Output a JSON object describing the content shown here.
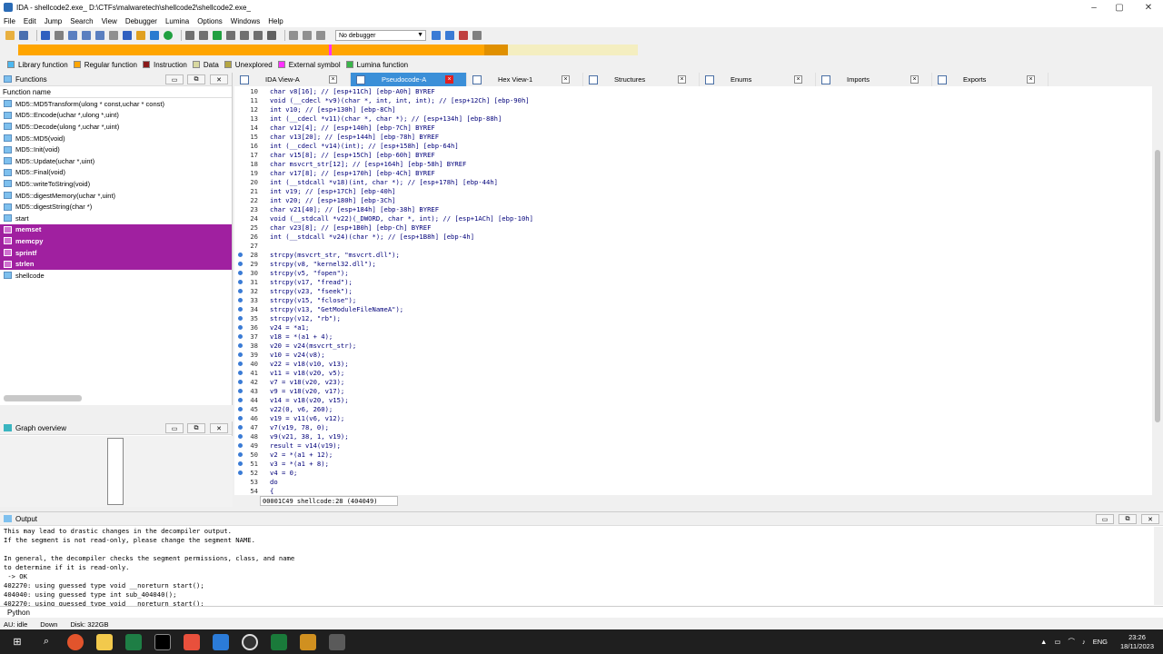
{
  "window": {
    "title": "IDA - shellcode2.exe_ D:\\CTFs\\malwaretech\\shellcode2\\shellcode2.exe_",
    "controls": [
      "–",
      "▢",
      "✕"
    ]
  },
  "menu": [
    "File",
    "Edit",
    "Jump",
    "Search",
    "View",
    "Debugger",
    "Lumina",
    "Options",
    "Windows",
    "Help"
  ],
  "toolbar": {
    "debugger": "No debugger"
  },
  "legend": [
    {
      "label": "Library function",
      "color": "#4db8f0"
    },
    {
      "label": "Regular function",
      "color": "#ffa500"
    },
    {
      "label": "Instruction",
      "color": "#8b1a1a"
    },
    {
      "label": "Data",
      "color": "#d8d8a0"
    },
    {
      "label": "Unexplored",
      "color": "#b5a642"
    },
    {
      "label": "External symbol",
      "color": "#ff30ff"
    },
    {
      "label": "Lumina function",
      "color": "#3ab54a"
    }
  ],
  "functions": {
    "title": "Functions",
    "column": "Function name",
    "items": [
      {
        "name": "MD5::MD5Transform(ulong * const,uchar * const)",
        "lib": false
      },
      {
        "name": "MD5::Encode(uchar *,ulong *,uint)",
        "lib": false
      },
      {
        "name": "MD5::Decode(ulong *,uchar *,uint)",
        "lib": false
      },
      {
        "name": "MD5::MD5(void)",
        "lib": false
      },
      {
        "name": "MD5::Init(void)",
        "lib": false
      },
      {
        "name": "MD5::Update(uchar *,uint)",
        "lib": false
      },
      {
        "name": "MD5::Final(void)",
        "lib": false
      },
      {
        "name": "MD5::writeToString(void)",
        "lib": false
      },
      {
        "name": "MD5::digestMemory(uchar *,uint)",
        "lib": false
      },
      {
        "name": "MD5::digestString(char *)",
        "lib": false
      },
      {
        "name": "start",
        "lib": false
      },
      {
        "name": "memset",
        "lib": true
      },
      {
        "name": "memcpy",
        "lib": true
      },
      {
        "name": "sprintf",
        "lib": true
      },
      {
        "name": "strlen",
        "lib": true
      },
      {
        "name": "shellcode",
        "lib": false
      }
    ]
  },
  "graph_overview": {
    "title": "Graph overview"
  },
  "tabs": [
    {
      "label": "IDA View-A",
      "active": false
    },
    {
      "label": "Pseudocode-A",
      "active": true
    },
    {
      "label": "Hex View-1",
      "active": false
    },
    {
      "label": "Structures",
      "active": false
    },
    {
      "label": "Enums",
      "active": false
    },
    {
      "label": "Imports",
      "active": false
    },
    {
      "label": "Exports",
      "active": false
    }
  ],
  "code": [
    {
      "n": "10",
      "t": "char v8[16]; // [esp+11Ch] [ebp-A0h] BYREF",
      "dot": false
    },
    {
      "n": "11",
      "t": "void (__cdecl *v9)(char *, int, int, int); // [esp+12Ch] [ebp-90h]",
      "dot": false
    },
    {
      "n": "12",
      "t": "int v10; // [esp+130h] [ebp-8Ch]",
      "dot": false
    },
    {
      "n": "13",
      "t": "int (__cdecl *v11)(char *, char *); // [esp+134h] [ebp-88h]",
      "dot": false
    },
    {
      "n": "14",
      "t": "char v12[4]; // [esp+140h] [ebp-7Ch] BYREF",
      "dot": false
    },
    {
      "n": "15",
      "t": "char v13[20]; // [esp+144h] [ebp-78h] BYREF",
      "dot": false
    },
    {
      "n": "16",
      "t": "int (__cdecl *v14)(int); // [esp+158h] [ebp-64h]",
      "dot": false
    },
    {
      "n": "17",
      "t": "char v15[8]; // [esp+15Ch] [ebp-60h] BYREF",
      "dot": false
    },
    {
      "n": "18",
      "t": "char msvcrt_str[12]; // [esp+164h] [ebp-58h] BYREF",
      "dot": false
    },
    {
      "n": "19",
      "t": "char v17[8]; // [esp+170h] [ebp-4Ch] BYREF",
      "dot": false
    },
    {
      "n": "20",
      "t": "int (__stdcall *v18)(int, char *); // [esp+178h] [ebp-44h]",
      "dot": false
    },
    {
      "n": "21",
      "t": "int v19; // [esp+17Ch] [ebp-40h]",
      "dot": false
    },
    {
      "n": "22",
      "t": "int v20; // [esp+180h] [ebp-3Ch]",
      "dot": false
    },
    {
      "n": "23",
      "t": "char v21[40]; // [esp+184h] [ebp-38h] BYREF",
      "dot": false
    },
    {
      "n": "24",
      "t": "void (__stdcall *v22)(_DWORD, char *, int); // [esp+1ACh] [ebp-10h]",
      "dot": false
    },
    {
      "n": "25",
      "t": "char v23[8]; // [esp+1B0h] [ebp-Ch] BYREF",
      "dot": false
    },
    {
      "n": "26",
      "t": "int (__stdcall *v24)(char *); // [esp+1B8h] [ebp-4h]",
      "dot": false
    },
    {
      "n": "27",
      "t": "",
      "dot": false
    },
    {
      "n": "28",
      "t": "strcpy(msvcrt_str, \"msvcrt.dll\");",
      "dot": true
    },
    {
      "n": "29",
      "t": "strcpy(v8, \"kernel32.dll\");",
      "dot": true
    },
    {
      "n": "30",
      "t": "strcpy(v5, \"fopen\");",
      "dot": true
    },
    {
      "n": "31",
      "t": "strcpy(v17, \"fread\");",
      "dot": true
    },
    {
      "n": "32",
      "t": "strcpy(v23, \"fseek\");",
      "dot": true
    },
    {
      "n": "33",
      "t": "strcpy(v15, \"fclose\");",
      "dot": true
    },
    {
      "n": "34",
      "t": "strcpy(v13, \"GetModuleFileNameA\");",
      "dot": true
    },
    {
      "n": "35",
      "t": "strcpy(v12, \"rb\");",
      "dot": true
    },
    {
      "n": "36",
      "t": "v24 = *a1;",
      "dot": true
    },
    {
      "n": "37",
      "t": "v18 = *(a1 + 4);",
      "dot": true
    },
    {
      "n": "38",
      "t": "v20 = v24(msvcrt_str);",
      "dot": true
    },
    {
      "n": "39",
      "t": "v10 = v24(v8);",
      "dot": true
    },
    {
      "n": "40",
      "t": "v22 = v18(v10, v13);",
      "dot": true
    },
    {
      "n": "41",
      "t": "v11 = v18(v20, v5);",
      "dot": true
    },
    {
      "n": "42",
      "t": "v7 = v18(v20, v23);",
      "dot": true
    },
    {
      "n": "43",
      "t": "v9 = v18(v20, v17);",
      "dot": true
    },
    {
      "n": "44",
      "t": "v14 = v18(v20, v15);",
      "dot": true
    },
    {
      "n": "45",
      "t": "v22(0, v6, 260);",
      "dot": true
    },
    {
      "n": "46",
      "t": "v19 = v11(v6, v12);",
      "dot": true
    },
    {
      "n": "47",
      "t": "v7(v19, 78, 0);",
      "dot": true
    },
    {
      "n": "48",
      "t": "v9(v21, 38, 1, v19);",
      "dot": true
    },
    {
      "n": "49",
      "t": "result = v14(v19);",
      "dot": true
    },
    {
      "n": "50",
      "t": "v2 = *(a1 + 12);",
      "dot": true
    },
    {
      "n": "51",
      "t": "v3 = *(a1 + 8);",
      "dot": true
    },
    {
      "n": "52",
      "t": "v4 = 0;",
      "dot": true
    },
    {
      "n": "53",
      "t": "do",
      "dot": false
    },
    {
      "n": "54",
      "t": "{",
      "dot": false
    }
  ],
  "code_status": "00001C49 shellcode:28 (404049)",
  "output": {
    "title": "Output",
    "lines": "This may lead to drastic changes in the decompiler output.\nIf the segment is not read-only, please change the segment NAME.\n\nIn general, the decompiler checks the segment permissions, class, and name\nto determine if it is read-only.\n -> OK\n402270: using guessed type void __noreturn start();\n404040: using guessed type int sub_404040();\n402270: using guessed type void __noreturn start();"
  },
  "python_label": "Python",
  "status": {
    "au": "AU:  idle",
    "dir": "Down",
    "disk": "Disk: 322GB"
  },
  "tray": {
    "lang": "ENG",
    "time": "23:26",
    "date": "18/11/2023"
  }
}
